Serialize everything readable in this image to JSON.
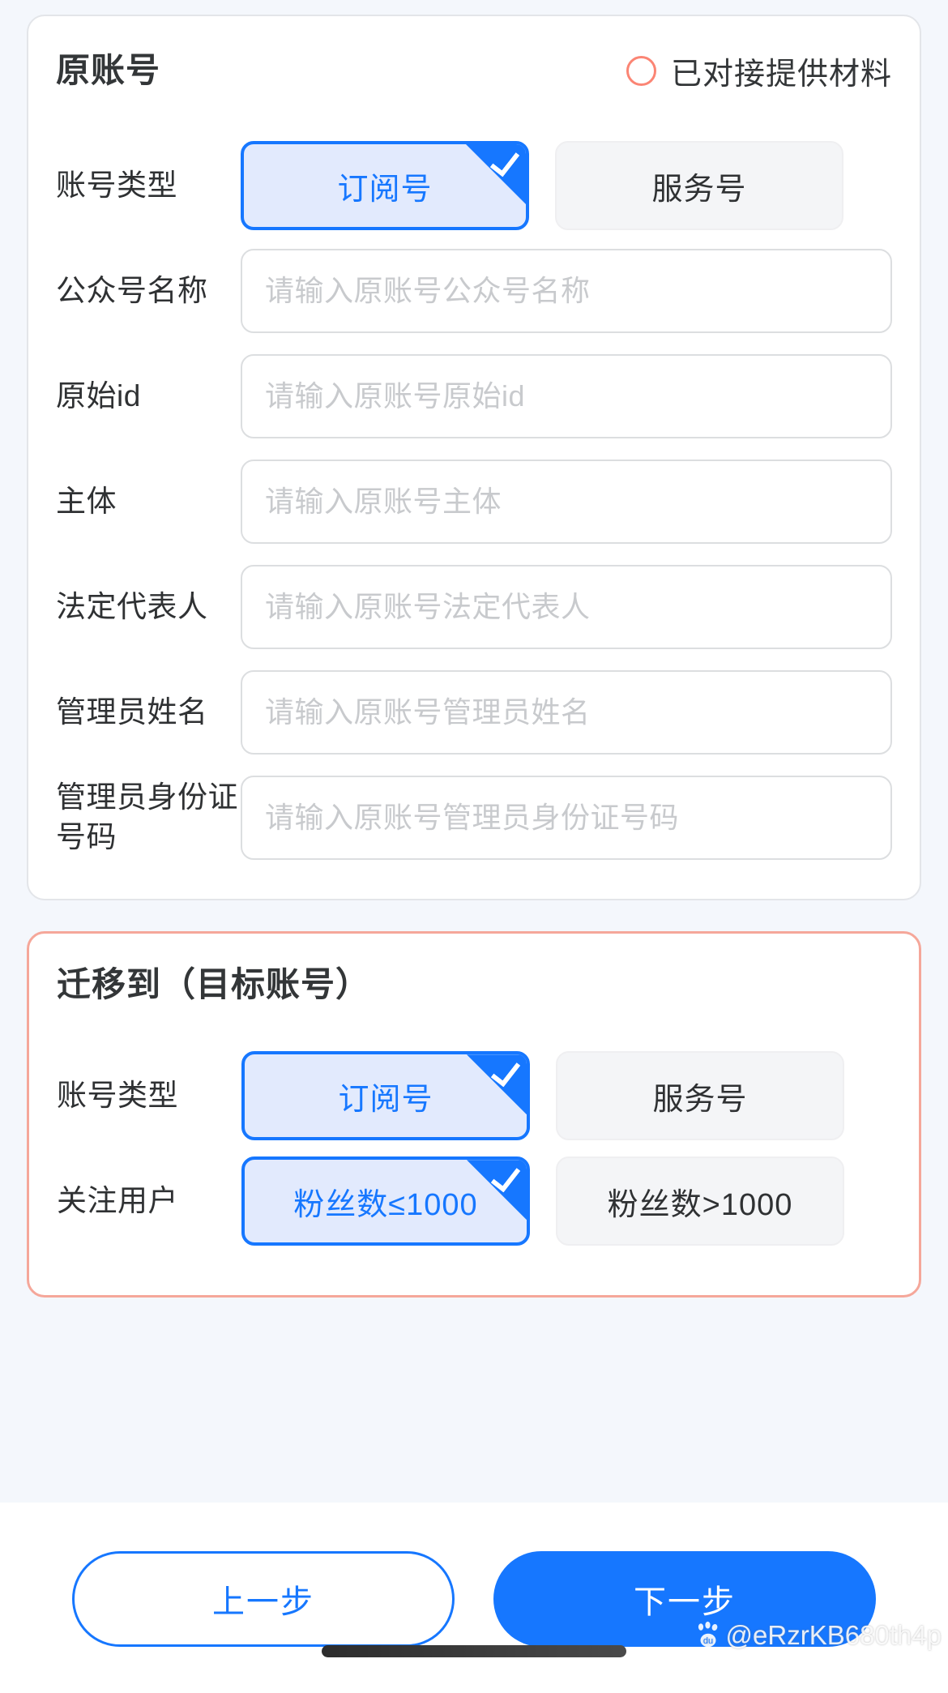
{
  "colors": {
    "accent": "#1677ff",
    "accent_soft": "#e2eafd",
    "page_bg": "#f4f7fc",
    "target_border": "#f5a79a",
    "radio_ring": "#fb8574",
    "chip_idle_bg": "#f4f5f7",
    "label_text": "#2f3133",
    "placeholder": "#c8cacd"
  },
  "origin_card": {
    "title": "原账号",
    "status": {
      "icon": "radio-circle-icon",
      "label": "已对接提供材料",
      "selected": false
    },
    "rows": [
      {
        "label": "账号类型",
        "type": "chips",
        "options": [
          {
            "label": "订阅号",
            "selected": true
          },
          {
            "label": "服务号",
            "selected": false
          }
        ]
      },
      {
        "label": "公众号名称",
        "type": "input",
        "value": "",
        "placeholder": "请输入原账号公众号名称"
      },
      {
        "label": "原始id",
        "type": "input",
        "value": "",
        "placeholder": "请输入原账号原始id"
      },
      {
        "label": "主体",
        "type": "input",
        "value": "",
        "placeholder": "请输入原账号主体"
      },
      {
        "label": "法定代表人",
        "type": "input",
        "value": "",
        "placeholder": "请输入原账号法定代表人"
      },
      {
        "label": "管理员姓名",
        "type": "input",
        "value": "",
        "placeholder": "请输入原账号管理员姓名"
      },
      {
        "label": "管理员身份证号码",
        "type": "input",
        "value": "",
        "placeholder": "请输入原账号管理员身份证号码"
      }
    ]
  },
  "target_card": {
    "title": "迁移到（目标账号）",
    "rows": [
      {
        "label": "账号类型",
        "type": "chips",
        "options": [
          {
            "label": "订阅号",
            "selected": true
          },
          {
            "label": "服务号",
            "selected": false
          }
        ]
      },
      {
        "label": "关注用户",
        "type": "chips",
        "options": [
          {
            "label": "粉丝数≤1000",
            "selected": true
          },
          {
            "label": "粉丝数>1000",
            "selected": false
          }
        ]
      }
    ]
  },
  "action_bar": {
    "prev_label": "上一步",
    "next_label": "下一步"
  },
  "watermark": {
    "icon": "paw-print-icon",
    "text": "@eRzrKB680th4p"
  }
}
